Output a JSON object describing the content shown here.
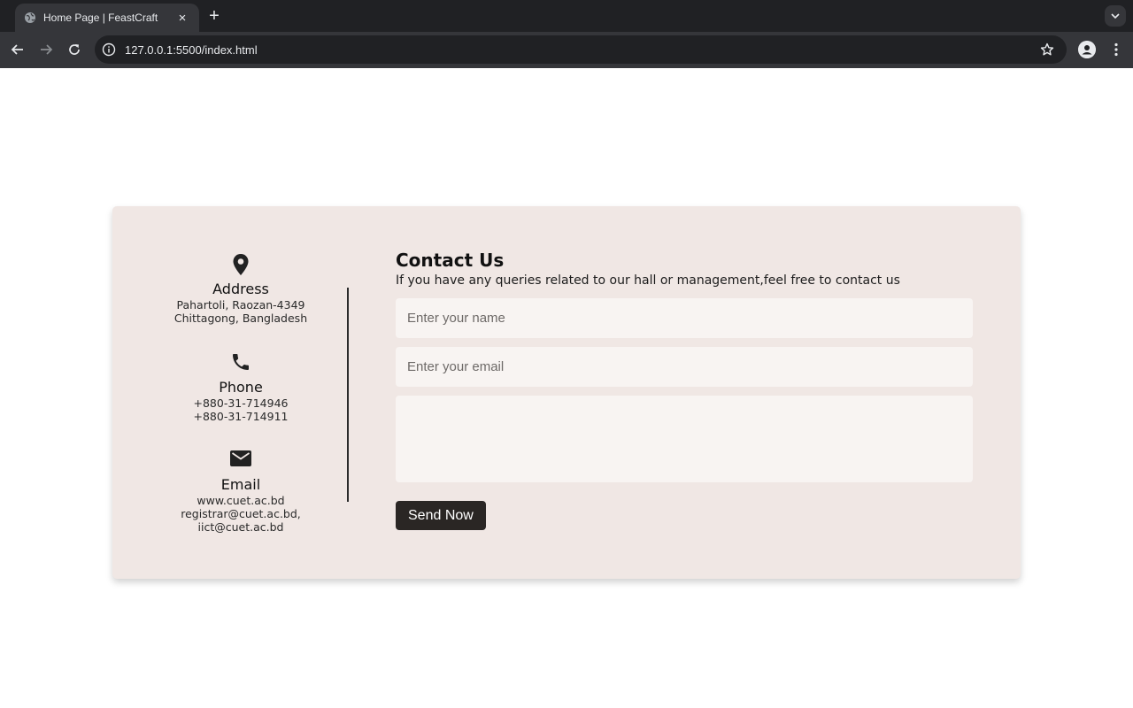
{
  "browser": {
    "tab_title": "Home Page | FeastCraft",
    "tab_close": "×",
    "new_tab": "+",
    "url": "127.0.0.1:5500/index.html"
  },
  "contact_info": {
    "address": {
      "icon": "map-pin-icon",
      "heading": "Address",
      "lines": [
        "Pahartoli, Raozan-4349",
        "Chittagong, Bangladesh"
      ]
    },
    "phone": {
      "icon": "phone-icon",
      "heading": "Phone",
      "lines": [
        "+880-31-714946",
        "+880-31-714911"
      ]
    },
    "email": {
      "icon": "envelope-icon",
      "heading": "Email",
      "lines": [
        "www.cuet.ac.bd",
        "registrar@cuet.ac.bd,",
        "iict@cuet.ac.bd"
      ]
    }
  },
  "form": {
    "title": "Contact Us",
    "subtitle": "If you have any queries related to our hall or management,feel free to contact us",
    "name_placeholder": "Enter your name",
    "email_placeholder": "Enter your email",
    "message_placeholder": "",
    "submit_label": "Send Now"
  },
  "colors": {
    "card_background": "#f0e7e4",
    "field_background": "#f8f4f2",
    "button_background": "#2a2624",
    "chrome_dark": "#202124",
    "chrome_toolbar": "#35363a"
  }
}
